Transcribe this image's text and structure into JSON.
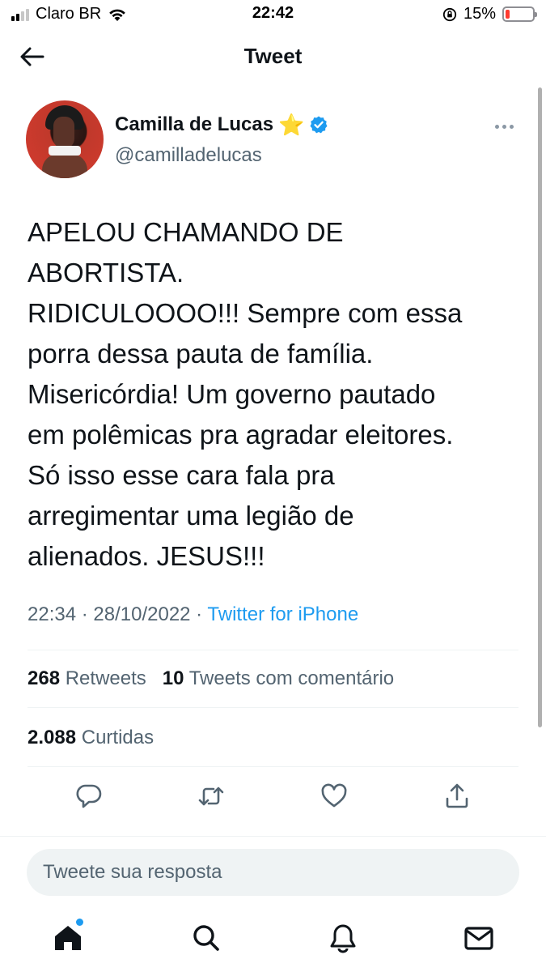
{
  "status_bar": {
    "carrier": "Claro BR",
    "time": "22:42",
    "battery_percent": "15%",
    "battery_level": 0.15,
    "signal_bars": 4,
    "signal_bars_active": 2
  },
  "header": {
    "title": "Tweet",
    "back_icon": "arrow-left-icon"
  },
  "tweet": {
    "author": {
      "name": "Camilla de Lucas",
      "name_emoji": "⭐",
      "handle": "@camilladelucas",
      "verified": true
    },
    "text": "APELOU CHAMANDO DE\nABORTISTA.\nRIDICULOOOO!!! Sempre com essa\nporra dessa pauta de família.\nMisericórdia! Um governo pautado\nem polêmicas pra agradar eleitores.\nSó isso esse cara fala pra\narregimentar uma legião de\nalienados. JESUS!!!",
    "time": "22:34",
    "separator": " · ",
    "date": "28/10/2022",
    "source": "Twitter for iPhone"
  },
  "stats": {
    "retweets_count": "268",
    "retweets_label": "Retweets",
    "quotes_count": "10",
    "quotes_label": "Tweets com comentário",
    "likes_count": "2.088",
    "likes_label": "Curtidas"
  },
  "actions": [
    "reply-icon",
    "retweet-icon",
    "like-icon",
    "share-icon"
  ],
  "reply": {
    "placeholder": "Tweete sua resposta"
  },
  "tab_bar": [
    "home-icon",
    "search-icon",
    "notifications-icon",
    "messages-icon"
  ],
  "colors": {
    "accent": "#1d9bf0",
    "text": "#0f1419",
    "muted": "#536471",
    "divider": "#eff3f4",
    "battery_low": "#ff3b30"
  }
}
